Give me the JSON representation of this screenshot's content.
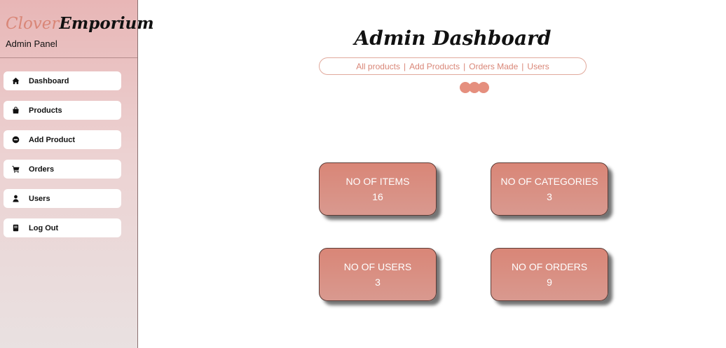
{
  "sidebar": {
    "brand_part1": "Clover",
    "brand_part2": "Emporium",
    "panel_label": "Admin Panel",
    "items": [
      {
        "label": "Dashboard",
        "icon": "home-icon"
      },
      {
        "label": "Products",
        "icon": "shopping-bag-icon"
      },
      {
        "label": "Add Product",
        "icon": "minus-circle-icon"
      },
      {
        "label": "Orders",
        "icon": "cart-icon"
      },
      {
        "label": "Users",
        "icon": "user-icon"
      },
      {
        "label": "Log Out",
        "icon": "logout-icon"
      }
    ]
  },
  "main": {
    "title": "Admin Dashboard",
    "links": [
      "All products",
      "Add Products",
      "Orders Made",
      "Users"
    ],
    "separator": "|",
    "stats": [
      {
        "label": "NO OF ITEMS",
        "value": "16"
      },
      {
        "label": "NO OF CATEGORIES",
        "value": "3"
      },
      {
        "label": "NO OF USERS",
        "value": "3"
      },
      {
        "label": "NO OF ORDERS",
        "value": "9"
      }
    ]
  },
  "colors": {
    "accent": "#d98677",
    "sidebar_top": "#e8b6b6",
    "sidebar_bottom": "#e9e1e1",
    "card_border": "#5a3b36"
  }
}
